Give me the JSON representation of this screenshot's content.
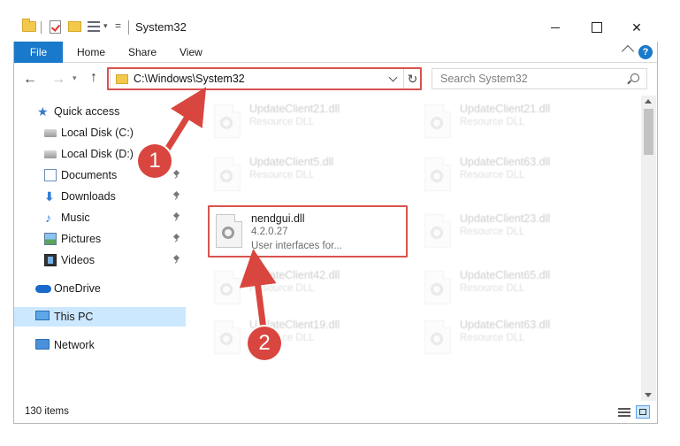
{
  "window": {
    "title": "System32",
    "controls": {
      "close_glyph": "✕"
    }
  },
  "ribbon": {
    "file": "File",
    "home": "Home",
    "share": "Share",
    "view": "View",
    "help": "?"
  },
  "nav": {
    "back": "←",
    "forward": "→",
    "up": "↑",
    "address": "C:\\Windows\\System32",
    "refresh": "↻",
    "search_placeholder": "Search System32"
  },
  "sidebar": {
    "items": [
      {
        "label": "Quick access",
        "icon": "star-icon",
        "pinned": false
      },
      {
        "label": "Local Disk (C:)",
        "icon": "drive-icon",
        "pinned": false
      },
      {
        "label": "Local Disk (D:)",
        "icon": "drive-icon",
        "pinned": false
      },
      {
        "label": "Documents",
        "icon": "documents-icon",
        "pinned": true
      },
      {
        "label": "Downloads",
        "icon": "download-icon",
        "pinned": true
      },
      {
        "label": "Music",
        "icon": "music-icon",
        "pinned": true
      },
      {
        "label": "Pictures",
        "icon": "pictures-icon",
        "pinned": true
      },
      {
        "label": "Videos",
        "icon": "videos-icon",
        "pinned": true
      },
      {
        "label": "OneDrive",
        "icon": "cloud-icon",
        "pinned": false
      },
      {
        "label": "This PC",
        "icon": "computer-icon",
        "pinned": false,
        "selected": true
      },
      {
        "label": "Network",
        "icon": "network-icon",
        "pinned": false
      }
    ]
  },
  "files": {
    "left": [
      {
        "name": "UpdateClient21.dll",
        "type": "Resource DLL",
        "faded": true
      },
      {
        "name": "UpdateClient5.dll",
        "type": "Resource DLL",
        "faded": true
      },
      {
        "name": "nendgui.dll",
        "type": "4.2.0.27",
        "desc": "User interfaces for...",
        "faded": false
      },
      {
        "name": "UpdateClient42.dll",
        "type": "Resource DLL",
        "faded": true
      },
      {
        "name": "UpdateClient19.dll",
        "type": "Resource DLL",
        "faded": true
      }
    ],
    "right": [
      {
        "name": "UpdateClient21.dll",
        "type": "Resource DLL",
        "faded": true
      },
      {
        "name": "UpdateClient63.dll",
        "type": "Resource DLL",
        "faded": true
      },
      {
        "name": "UpdateClient23.dll",
        "type": "Resource DLL",
        "faded": true
      },
      {
        "name": "UpdateClient65.dll",
        "type": "Resource DLL",
        "faded": true
      },
      {
        "name": "UpdateClient63.dll",
        "type": "Resource DLL",
        "faded": true
      }
    ]
  },
  "status": {
    "item_count": "130 items"
  },
  "annotations": {
    "step1": "1",
    "step2": "2",
    "highlight_color": "#d9534f"
  }
}
